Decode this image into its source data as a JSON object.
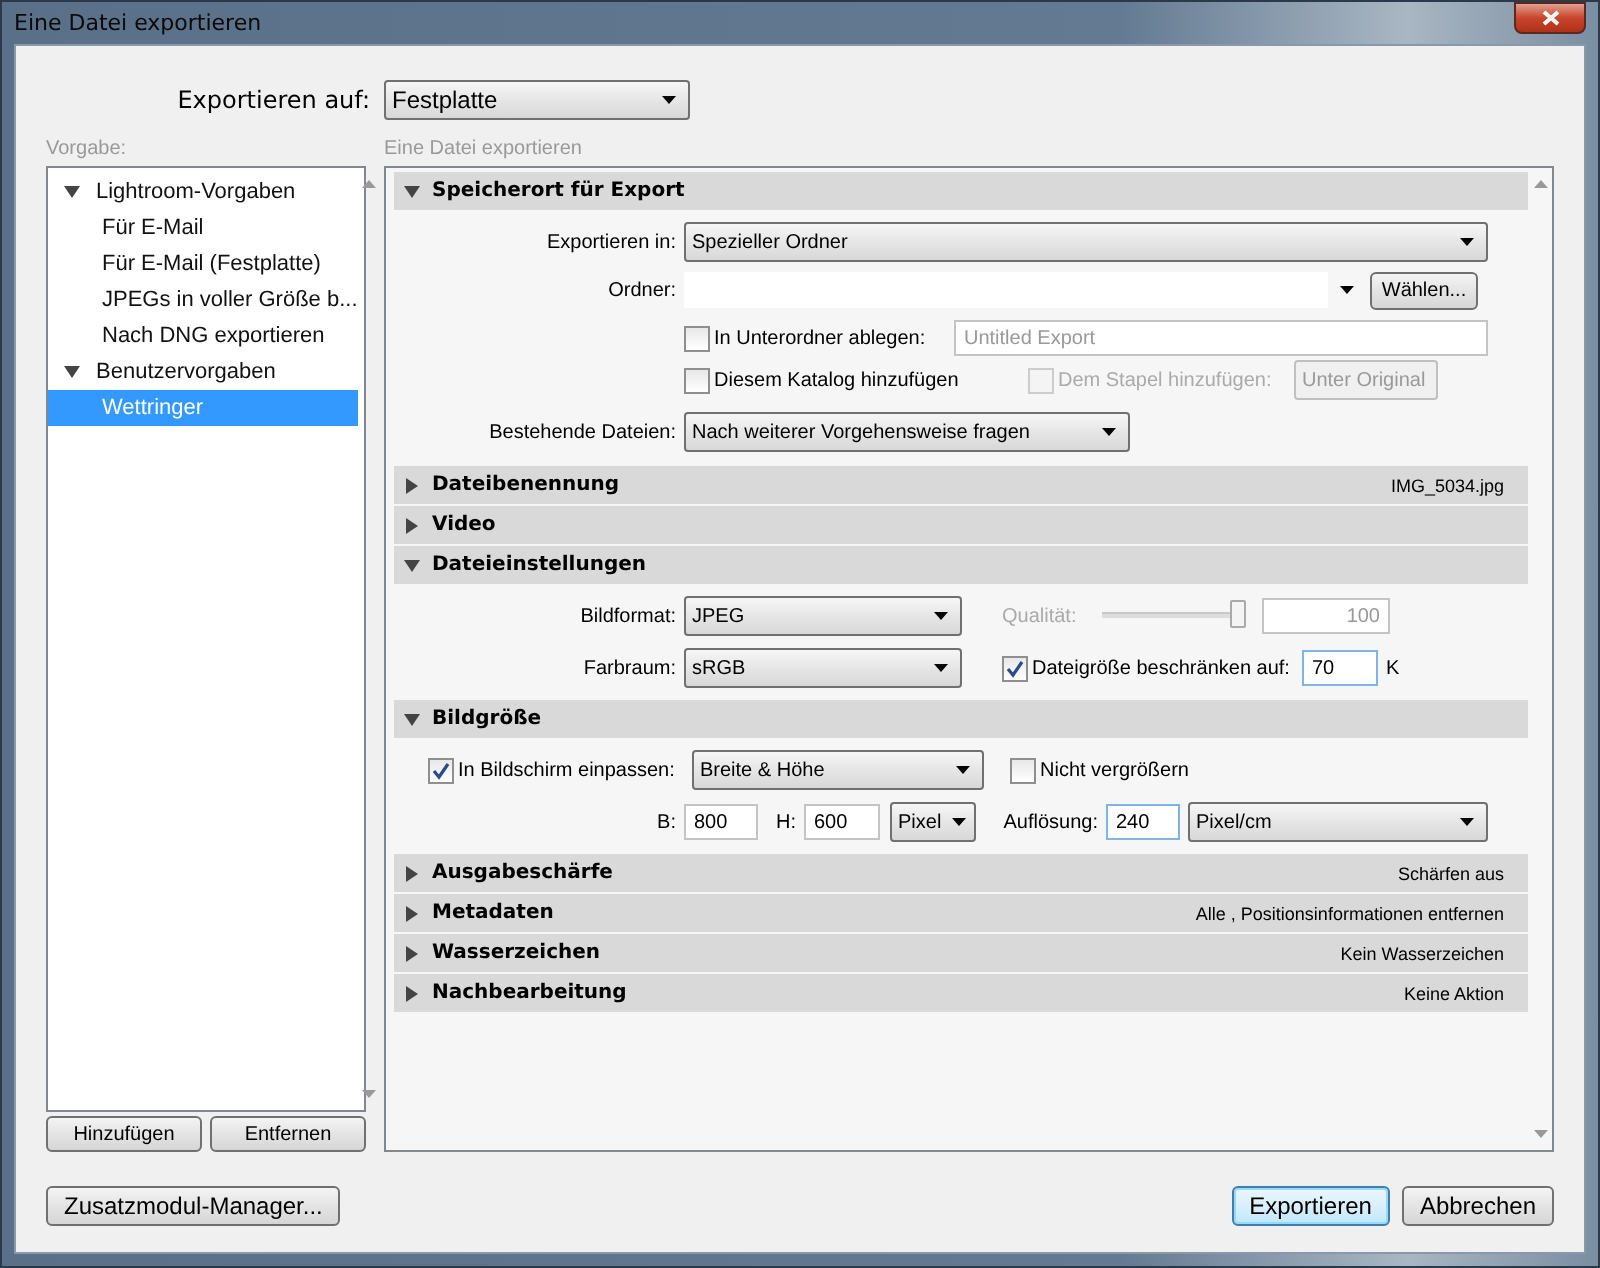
{
  "window": {
    "title": "Eine Datei exportieren"
  },
  "export_to": {
    "label": "Exportieren auf:",
    "value": "Festplatte"
  },
  "presets": {
    "label": "Vorgabe:",
    "items": [
      {
        "label": "Lightroom-Vorgaben",
        "expanded": true,
        "selected": false,
        "children": [
          {
            "label": "Für E-Mail",
            "selected": false
          },
          {
            "label": "Für E-Mail (Festplatte)",
            "selected": false
          },
          {
            "label": "JPEGs in voller Größe b...",
            "selected": false
          },
          {
            "label": "Nach DNG exportieren",
            "selected": false
          }
        ]
      },
      {
        "label": "Benutzervorgaben",
        "expanded": true,
        "selected": false,
        "children": [
          {
            "label": "Wettringer",
            "selected": true
          }
        ]
      }
    ],
    "buttons": [
      "Hinzufügen",
      "Entfernen"
    ]
  },
  "panel": {
    "label": "Eine Datei exportieren",
    "sections": [
      {
        "kind": "location",
        "title": "Speicherort für Export",
        "expanded": true,
        "export_in": {
          "label": "Exportieren in:",
          "value": "Spezieller Ordner"
        },
        "folder": {
          "label": "Ordner:",
          "button": "Wählen..."
        },
        "subfolder": {
          "label": "In Unterordner ablegen:",
          "checked": false,
          "value": "Untitled Export"
        },
        "catalog": {
          "label": "Diesem Katalog hinzufügen",
          "checked": false
        },
        "stack": {
          "label": "Dem Stapel hinzufügen:",
          "checked": false,
          "disabled": true,
          "value": "Unter Original"
        },
        "existing": {
          "label": "Bestehende Dateien:",
          "value": "Nach weiterer Vorgehensweise fragen"
        }
      },
      {
        "title": "Dateibenennung",
        "expanded": false,
        "summary": "IMG_5034.jpg"
      },
      {
        "title": "Video",
        "expanded": false
      },
      {
        "kind": "file_settings",
        "title": "Dateieinstellungen",
        "expanded": true,
        "format": {
          "label": "Bildformat:",
          "value": "JPEG"
        },
        "quality": {
          "label": "Qualität:",
          "disabled": true,
          "level": 1,
          "value": "100"
        },
        "color_space": {
          "label": "Farbraum:",
          "value": "sRGB"
        },
        "limit": {
          "label": "Dateigröße beschränken auf:",
          "checked": true,
          "value": "70",
          "unit": "K"
        }
      },
      {
        "kind": "image_size",
        "title": "Bildgröße",
        "expanded": true,
        "fit": {
          "label": "In Bildschirm einpassen:",
          "checked": true,
          "value": "Breite & Höhe"
        },
        "no_enlarge": {
          "label": "Nicht vergrößern",
          "checked": false
        },
        "width": {
          "label": "B:",
          "value": "800"
        },
        "height": {
          "label": "H:",
          "value": "600"
        },
        "unit": {
          "value": "Pixel"
        },
        "resolution": {
          "label": "Auflösung:",
          "value": "240"
        },
        "res_unit": {
          "value": "Pixel/cm"
        }
      },
      {
        "title": "Ausgabeschärfe",
        "expanded": false,
        "summary": "Schärfen aus"
      },
      {
        "title": "Metadaten",
        "expanded": false,
        "summary": "Alle , Positionsinformationen entfernen"
      },
      {
        "title": "Wasserzeichen",
        "expanded": false,
        "summary": "Kein Wasserzeichen"
      },
      {
        "title": "Nachbearbeitung",
        "expanded": false,
        "summary": "Keine Aktion"
      }
    ]
  },
  "footer": {
    "left": [
      {
        "label": "Zusatzmodul-Manager...",
        "default": false
      }
    ],
    "right": [
      {
        "label": "Exportieren",
        "default": true
      },
      {
        "label": "Abbrechen",
        "default": false
      }
    ]
  }
}
